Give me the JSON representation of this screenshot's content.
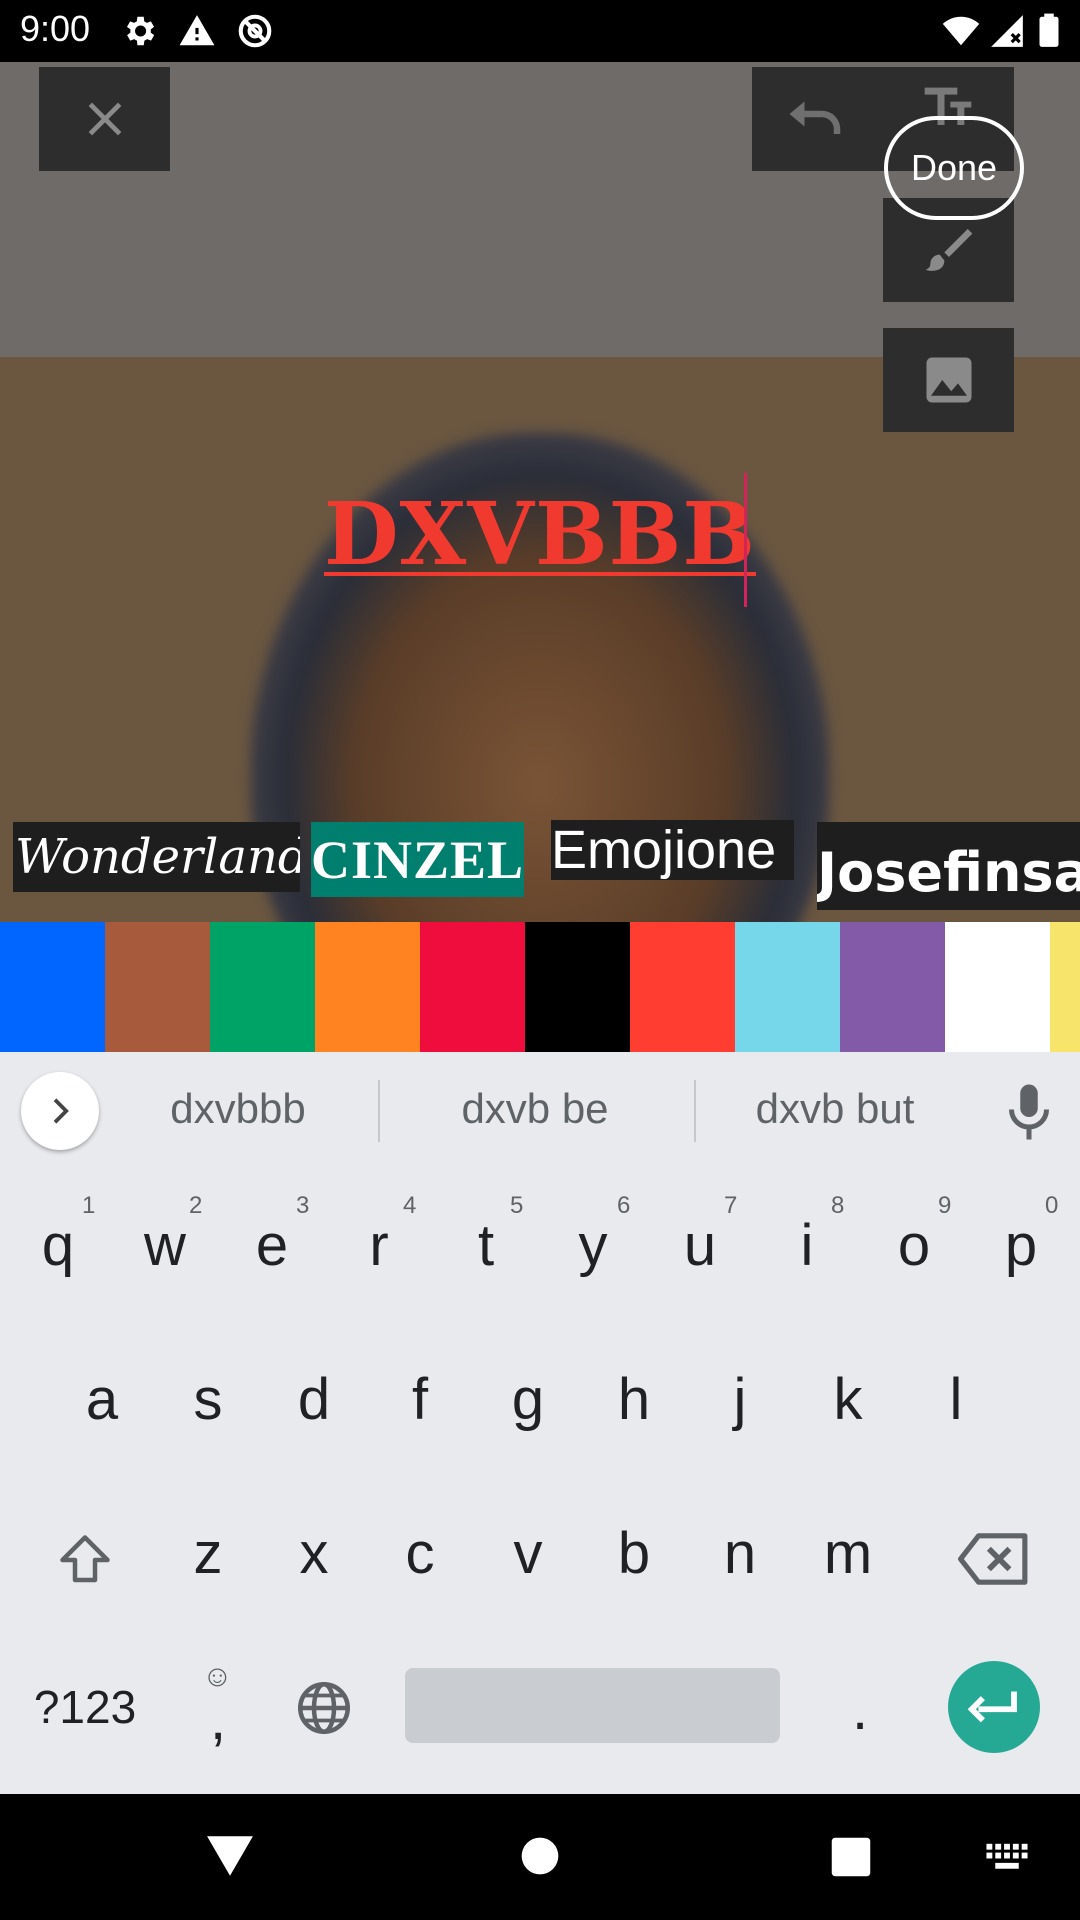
{
  "status_bar": {
    "time": "9:00"
  },
  "editor": {
    "done_label": "Done",
    "overlay_text": "DXVBBB"
  },
  "fonts": [
    {
      "label": "Wonderland"
    },
    {
      "label": "CINZEL"
    },
    {
      "label": "Emojione"
    },
    {
      "label": "Josefinsans"
    }
  ],
  "colors": [
    "#0066ff",
    "#a85a3c",
    "#00a366",
    "#ff8320",
    "#ee0d3d",
    "#000000",
    "#ff3d30",
    "#76d6ea",
    "#835aa8",
    "#ffffff",
    "#f7e46b"
  ],
  "keyboard": {
    "suggestions": [
      "dxvbbb",
      "dxvb be",
      "dxvb but"
    ],
    "row1": [
      {
        "k": "q",
        "h": "1"
      },
      {
        "k": "w",
        "h": "2"
      },
      {
        "k": "e",
        "h": "3"
      },
      {
        "k": "r",
        "h": "4"
      },
      {
        "k": "t",
        "h": "5"
      },
      {
        "k": "y",
        "h": "6"
      },
      {
        "k": "u",
        "h": "7"
      },
      {
        "k": "i",
        "h": "8"
      },
      {
        "k": "o",
        "h": "9"
      },
      {
        "k": "p",
        "h": "0"
      }
    ],
    "row2": [
      "a",
      "s",
      "d",
      "f",
      "g",
      "h",
      "j",
      "k",
      "l"
    ],
    "row3": [
      "z",
      "x",
      "c",
      "v",
      "b",
      "n",
      "m"
    ],
    "symbols_label": "?123",
    "comma_label": ",",
    "period_label": "."
  }
}
